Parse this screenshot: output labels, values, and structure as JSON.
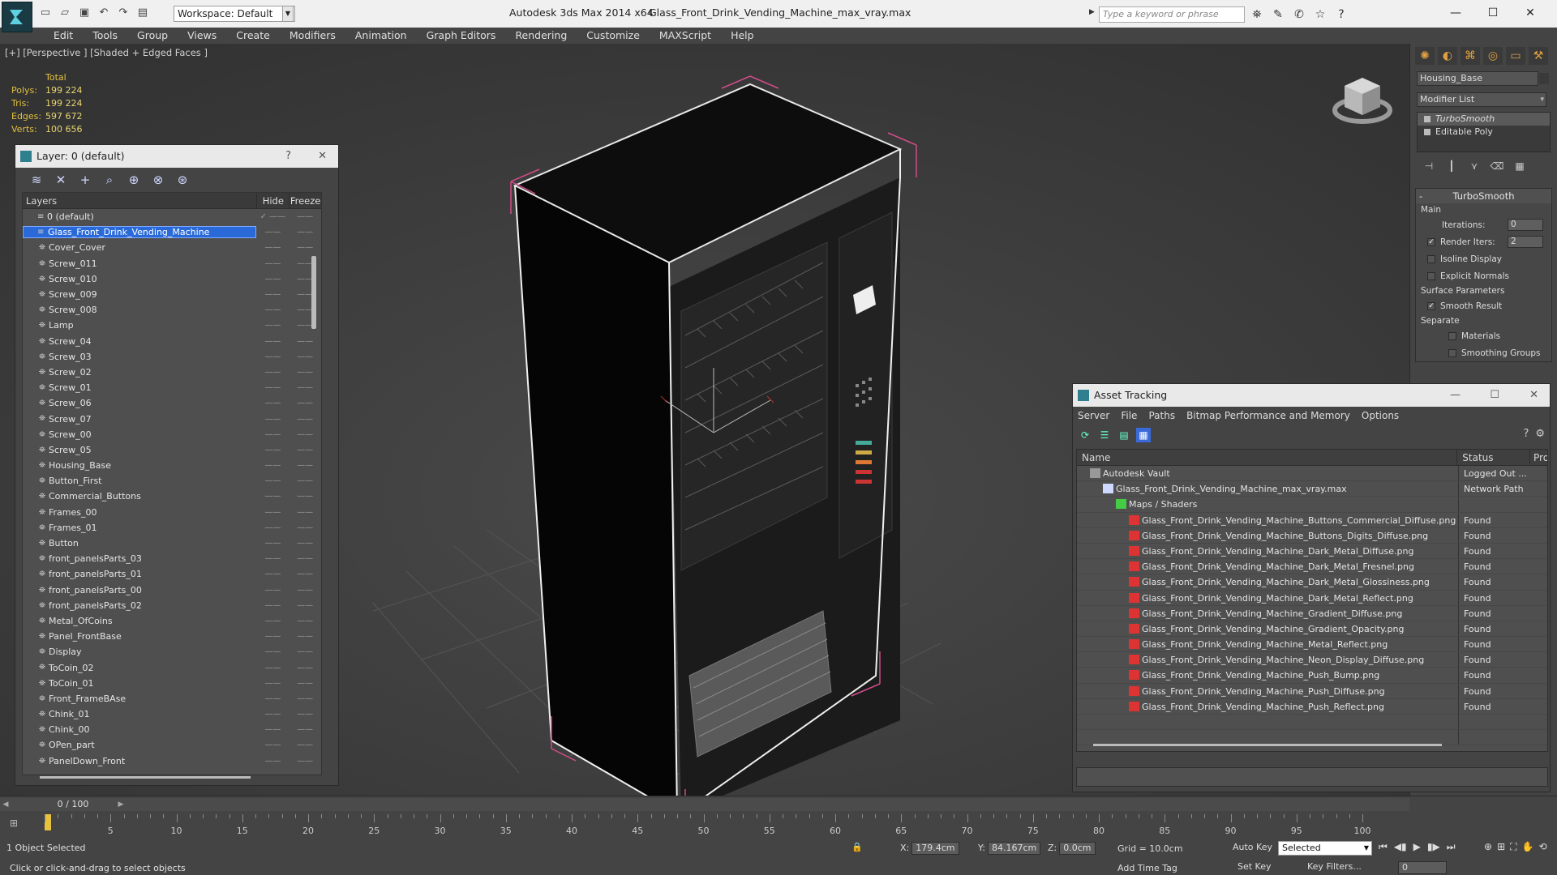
{
  "window": {
    "app_title": "Autodesk 3ds Max  2014 x64",
    "file_title": "Glass_Front_Drink_Vending_Machine_max_vray.max",
    "workspace": "Workspace: Default",
    "search_placeholder": "Type a keyword or phrase"
  },
  "menu": [
    "Edit",
    "Tools",
    "Group",
    "Views",
    "Create",
    "Modifiers",
    "Animation",
    "Graph Editors",
    "Rendering",
    "Customize",
    "MAXScript",
    "Help"
  ],
  "viewport": {
    "label": "[+] [Perspective ] [Shaded + Edged Faces ]",
    "stats": {
      "header": "Total",
      "polys_label": "Polys:",
      "polys": "199 224",
      "tris_label": "Tris:",
      "tris": "199 224",
      "edges_label": "Edges:",
      "edges": "597 672",
      "verts_label": "Verts:",
      "verts": "100 656"
    }
  },
  "layer_panel": {
    "title": "Layer: 0 (default)",
    "help": "?",
    "col_layers": "Layers",
    "col_hide": "Hide",
    "col_freeze": "Freeze",
    "rows": [
      {
        "name": "0 (default)",
        "level": 0,
        "selected": false
      },
      {
        "name": "Glass_Front_Drink_Vending_Machine",
        "level": 0,
        "selected": true
      },
      {
        "name": "Cover_Cover",
        "level": 1
      },
      {
        "name": "Screw_011",
        "level": 1
      },
      {
        "name": "Screw_010",
        "level": 1
      },
      {
        "name": "Screw_009",
        "level": 1
      },
      {
        "name": "Screw_008",
        "level": 1
      },
      {
        "name": "Lamp",
        "level": 1
      },
      {
        "name": "Screw_04",
        "level": 1
      },
      {
        "name": "Screw_03",
        "level": 1
      },
      {
        "name": "Screw_02",
        "level": 1
      },
      {
        "name": "Screw_01",
        "level": 1
      },
      {
        "name": "Screw_06",
        "level": 1
      },
      {
        "name": "Screw_07",
        "level": 1
      },
      {
        "name": "Screw_00",
        "level": 1
      },
      {
        "name": "Screw_05",
        "level": 1
      },
      {
        "name": "Housing_Base",
        "level": 1
      },
      {
        "name": "Button_First",
        "level": 1
      },
      {
        "name": "Commercial_Buttons",
        "level": 1
      },
      {
        "name": "Frames_00",
        "level": 1
      },
      {
        "name": "Frames_01",
        "level": 1
      },
      {
        "name": "Button",
        "level": 1
      },
      {
        "name": "front_panelsParts_03",
        "level": 1
      },
      {
        "name": "front_panelsParts_01",
        "level": 1
      },
      {
        "name": "front_panelsParts_00",
        "level": 1
      },
      {
        "name": "front_panelsParts_02",
        "level": 1
      },
      {
        "name": "Metal_OfCoins",
        "level": 1
      },
      {
        "name": "Panel_FrontBase",
        "level": 1
      },
      {
        "name": "Display",
        "level": 1
      },
      {
        "name": "ToCoin_02",
        "level": 1
      },
      {
        "name": "ToCoin_01",
        "level": 1
      },
      {
        "name": "Front_FrameBAse",
        "level": 1
      },
      {
        "name": "Chink_01",
        "level": 1
      },
      {
        "name": "Chink_00",
        "level": 1
      },
      {
        "name": "OPen_part",
        "level": 1
      },
      {
        "name": "PanelDown_Front",
        "level": 1
      }
    ]
  },
  "command_panel": {
    "object_name": "Housing_Base",
    "modifier_list": "Modifier List",
    "stack": [
      "TurboSmooth",
      "Editable Poly"
    ],
    "rollout_title": "TurboSmooth",
    "group_main": "Main",
    "iterations_label": "Iterations:",
    "iterations": "0",
    "render_iters_label": "Render Iters:",
    "render_iters": "2",
    "isoline": "Isoline Display",
    "explicit": "Explicit Normals",
    "group_surface": "Surface Parameters",
    "smooth_result": "Smooth Result",
    "separate": "Separate",
    "materials": "Materials",
    "smoothing_groups": "Smoothing Groups"
  },
  "asset_panel": {
    "title": "Asset Tracking",
    "menu": [
      "Server",
      "File",
      "Paths",
      "Bitmap Performance and Memory",
      "Options"
    ],
    "col_name": "Name",
    "col_status": "Status",
    "col_pro": "Pro",
    "rows": [
      {
        "name": "Autodesk Vault",
        "status": "Logged Out ...",
        "indent": 1,
        "type": "vault"
      },
      {
        "name": "Glass_Front_Drink_Vending_Machine_max_vray.max",
        "status": "Network Path",
        "indent": 2,
        "type": "max"
      },
      {
        "name": "Maps / Shaders",
        "status": "",
        "indent": 3,
        "type": "maps"
      },
      {
        "name": "Glass_Front_Drink_Vending_Machine_Buttons_Commercial_Diffuse.png",
        "status": "Found",
        "indent": 4,
        "type": "png"
      },
      {
        "name": "Glass_Front_Drink_Vending_Machine_Buttons_Digits_Diffuse.png",
        "status": "Found",
        "indent": 4,
        "type": "png"
      },
      {
        "name": "Glass_Front_Drink_Vending_Machine_Dark_Metal_Diffuse.png",
        "status": "Found",
        "indent": 4,
        "type": "png"
      },
      {
        "name": "Glass_Front_Drink_Vending_Machine_Dark_Metal_Fresnel.png",
        "status": "Found",
        "indent": 4,
        "type": "png"
      },
      {
        "name": "Glass_Front_Drink_Vending_Machine_Dark_Metal_Glossiness.png",
        "status": "Found",
        "indent": 4,
        "type": "png"
      },
      {
        "name": "Glass_Front_Drink_Vending_Machine_Dark_Metal_Reflect.png",
        "status": "Found",
        "indent": 4,
        "type": "png"
      },
      {
        "name": "Glass_Front_Drink_Vending_Machine_Gradient_Diffuse.png",
        "status": "Found",
        "indent": 4,
        "type": "png"
      },
      {
        "name": "Glass_Front_Drink_Vending_Machine_Gradient_Opacity.png",
        "status": "Found",
        "indent": 4,
        "type": "png"
      },
      {
        "name": "Glass_Front_Drink_Vending_Machine_Metal_Reflect.png",
        "status": "Found",
        "indent": 4,
        "type": "png"
      },
      {
        "name": "Glass_Front_Drink_Vending_Machine_Neon_Display_Diffuse.png",
        "status": "Found",
        "indent": 4,
        "type": "png"
      },
      {
        "name": "Glass_Front_Drink_Vending_Machine_Push_Bump.png",
        "status": "Found",
        "indent": 4,
        "type": "png"
      },
      {
        "name": "Glass_Front_Drink_Vending_Machine_Push_Diffuse.png",
        "status": "Found",
        "indent": 4,
        "type": "png"
      },
      {
        "name": "Glass_Front_Drink_Vending_Machine_Push_Reflect.png",
        "status": "Found",
        "indent": 4,
        "type": "png"
      }
    ]
  },
  "timeline": {
    "frame_counter": "0 / 100",
    "ticks": [
      "5",
      "10",
      "15",
      "20",
      "25",
      "30",
      "35",
      "40",
      "45",
      "50",
      "55",
      "60",
      "65",
      "70",
      "75",
      "80",
      "85",
      "90",
      "95",
      "100"
    ]
  },
  "status": {
    "selection": "1 Object Selected",
    "prompt": "Click or click-and-drag to select objects",
    "x_label": "X:",
    "x": "179.4cm",
    "y_label": "Y:",
    "y": "84.167cm",
    "z_label": "Z:",
    "z": "0.0cm",
    "grid": "Grid = 10.0cm",
    "add_time_tag": "Add Time Tag",
    "auto_key": "Auto Key",
    "set_key": "Set Key",
    "selected": "Selected",
    "key_filters": "Key Filters...",
    "frame": "0"
  }
}
